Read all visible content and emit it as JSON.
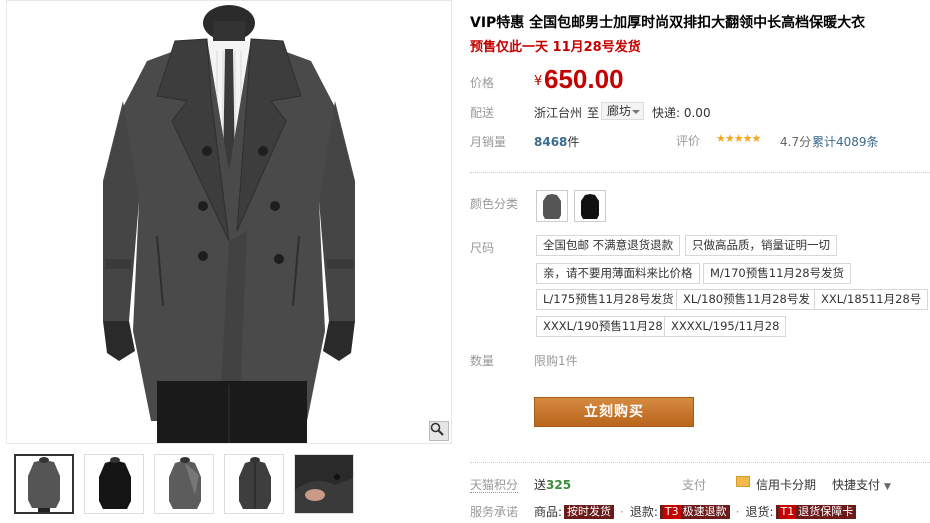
{
  "product": {
    "title": "VIP特惠 全国包邮男士加厚时尚双排扣大翻领中长高档保暖大衣",
    "subtitle": "预售仅此一天 11月28号发货"
  },
  "price": {
    "label": "价格",
    "symbol": "¥",
    "value": "650.00"
  },
  "shipping": {
    "label": "配送",
    "from": "浙江台州",
    "to_label": "至",
    "to_value": "廊坊",
    "fee": "快递: 0.00"
  },
  "sales": {
    "label": "月销量",
    "count": "8468",
    "unit": "件"
  },
  "rating": {
    "label": "评价",
    "stars": "★★★★★",
    "score": "4.7分",
    "count_text": "累计4089条"
  },
  "color": {
    "label": "颜色分类",
    "options": [
      "grey-coat",
      "black-coat"
    ]
  },
  "size": {
    "label": "尺码",
    "options": [
      "全国包邮 不满意退货退款",
      "只做高品质，销量证明一切",
      "亲，请不要用薄面料来比价格",
      "M/170预售11月28号发货",
      "L/175预售11月28号发货",
      "XL/180预售11月28号发",
      "XXL/18511月28号",
      "XXXL/190预售11月28",
      "XXXXL/195/11月28"
    ]
  },
  "quantity": {
    "label": "数量",
    "value": "限购1件"
  },
  "buy_button": "立刻购买",
  "points": {
    "label": "天猫积分",
    "prefix": "送",
    "value": "325"
  },
  "payment": {
    "label": "支付",
    "credit": "信用卡分期",
    "quickpay": "快捷支付"
  },
  "service": {
    "label": "服务承诺",
    "items": [
      {
        "text": "商品:",
        "code": "",
        "tag": "按时发货"
      },
      {
        "text": "退款:",
        "code": "T3",
        "tag": "极速退款"
      },
      {
        "text": "退货:",
        "code": "T1",
        "tag": "退货保障卡"
      }
    ]
  },
  "colors": {
    "price_red": "#c40000",
    "link_blue": "#3a6b8c",
    "buy_orange": "#c67530",
    "star_gold": "#f5a623"
  }
}
